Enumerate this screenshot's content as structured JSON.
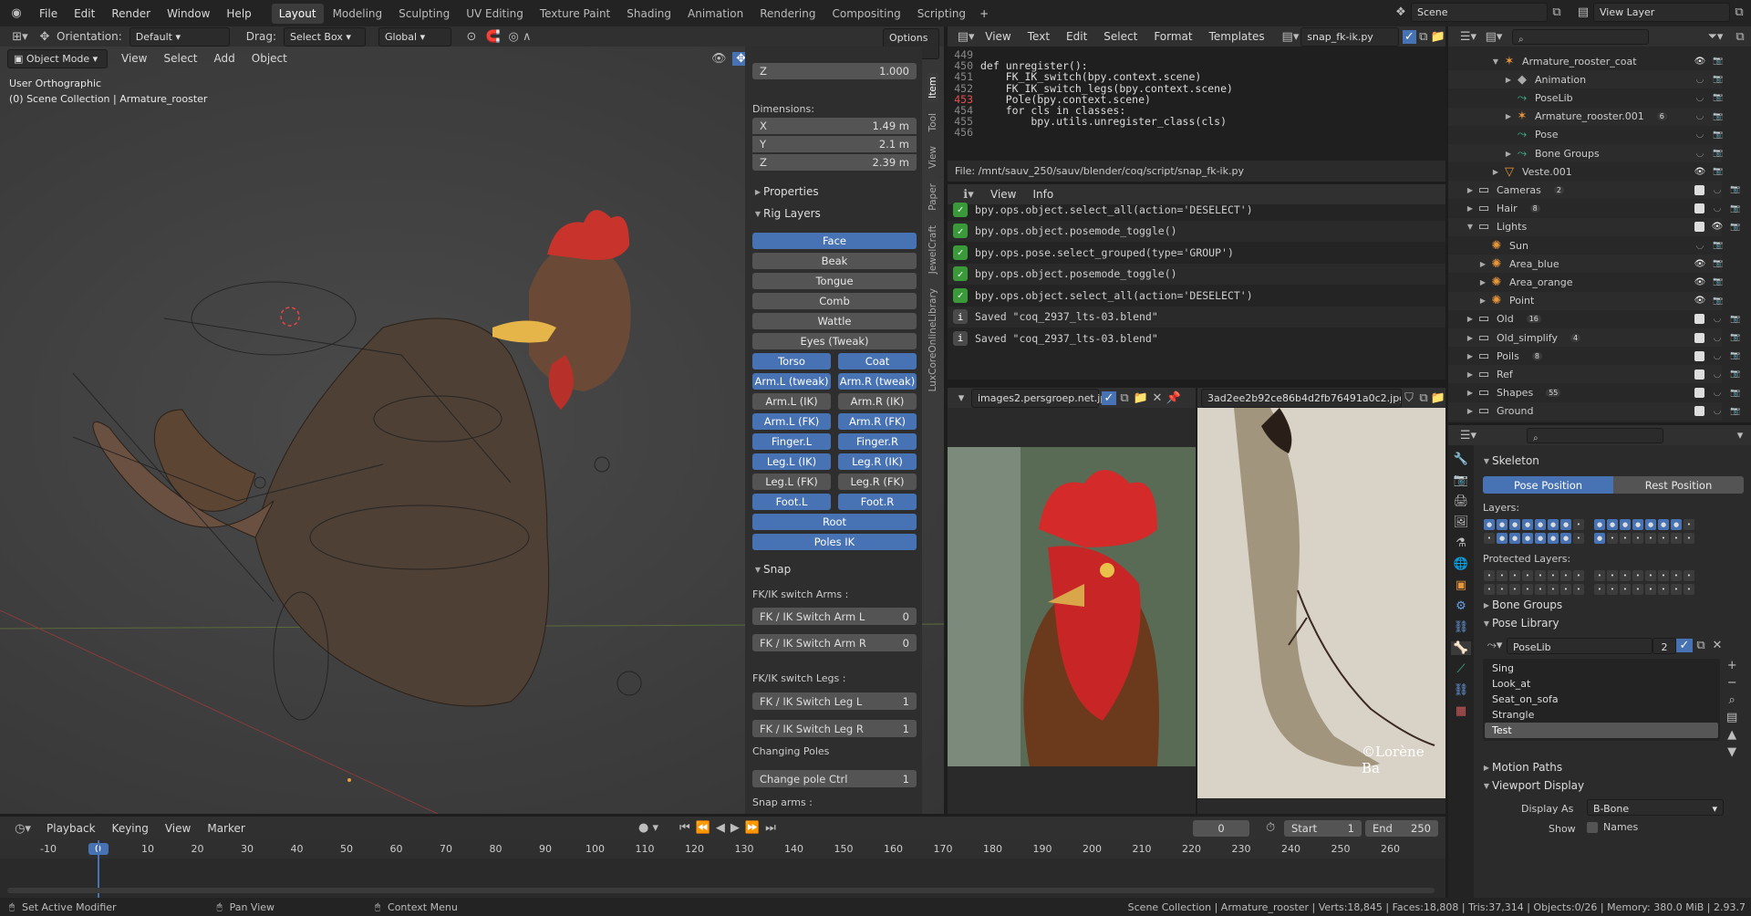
{
  "topbar": {
    "menus": [
      "File",
      "Edit",
      "Render",
      "Window",
      "Help"
    ],
    "workspaces": [
      "Layout",
      "Modeling",
      "Sculpting",
      "UV Editing",
      "Texture Paint",
      "Shading",
      "Animation",
      "Rendering",
      "Compositing",
      "Scripting"
    ],
    "active_workspace": "Layout",
    "add_tab": "+",
    "scene_label": "Scene",
    "view_layer_label": "View Layer"
  },
  "viewport": {
    "orientation_label": "Orientation:",
    "orientation_value": "Default",
    "drag_label": "Drag:",
    "drag_value": "Select Box",
    "transform_value": "Global",
    "options_label": "Options",
    "mode": "Object Mode",
    "menus": [
      "View",
      "Select",
      "Add",
      "Object"
    ],
    "overlay_line1": "User Orthographic",
    "overlay_line2": "(0) Scene Collection | Armature_rooster"
  },
  "npanel": {
    "z_label": "Z",
    "z_value": "1.000",
    "dimensions_label": "Dimensions:",
    "dims": [
      {
        "axis": "X",
        "value": "1.49 m"
      },
      {
        "axis": "Y",
        "value": "2.1 m"
      },
      {
        "axis": "Z",
        "value": "2.39 m"
      }
    ],
    "properties_label": "Properties",
    "rig_layers_label": "Rig Layers",
    "rig_buttons": [
      [
        {
          "label": "Face",
          "on": true
        }
      ],
      [
        {
          "label": "Beak",
          "on": false
        }
      ],
      [
        {
          "label": "Tongue",
          "on": false
        }
      ],
      [
        {
          "label": "Comb",
          "on": false
        }
      ],
      [
        {
          "label": "Wattle",
          "on": false
        }
      ],
      [
        {
          "label": "Eyes (Tweak)",
          "on": false
        }
      ],
      [
        {
          "label": "Torso",
          "on": true
        },
        {
          "label": "Coat",
          "on": true
        }
      ],
      [
        {
          "label": "Arm.L (tweak)",
          "on": true
        },
        {
          "label": "Arm.R (tweak)",
          "on": true
        }
      ],
      [
        {
          "label": "Arm.L (IK)",
          "on": false
        },
        {
          "label": "Arm.R (IK)",
          "on": false
        }
      ],
      [
        {
          "label": "Arm.L (FK)",
          "on": true
        },
        {
          "label": "Arm.R (FK)",
          "on": true
        }
      ],
      [
        {
          "label": "Finger.L",
          "on": true
        },
        {
          "label": "Finger.R",
          "on": true
        }
      ],
      [
        {
          "label": "Leg.L (IK)",
          "on": true
        },
        {
          "label": "Leg.R (IK)",
          "on": true
        }
      ],
      [
        {
          "label": "Leg.L (FK)",
          "on": false
        },
        {
          "label": "Leg.R (FK)",
          "on": false
        }
      ],
      [
        {
          "label": "Foot.L",
          "on": true
        },
        {
          "label": "Foot.R",
          "on": true
        }
      ],
      [
        {
          "label": "Root",
          "on": true
        }
      ],
      [
        {
          "label": "Poles IK",
          "on": true
        }
      ]
    ],
    "snap_label": "Snap",
    "fkik_arms_label": "FK/IK switch Arms :",
    "arm_l": {
      "label": "FK / IK Switch Arm L",
      "value": "0"
    },
    "arm_r": {
      "label": "FK / IK Switch Arm R",
      "value": "0"
    },
    "fkik_legs_label": "FK/IK switch Legs :",
    "leg_l": {
      "label": "FK / IK Switch Leg L",
      "value": "1"
    },
    "leg_r": {
      "label": "FK / IK Switch Leg R",
      "value": "1"
    },
    "changing_poles_label": "Changing Poles",
    "pole": {
      "label": "Change pole Ctrl",
      "value": "1"
    },
    "snap_arms_label": "Snap arms :",
    "side_tabs": [
      "Item",
      "Tool",
      "View",
      "Paper",
      "JewelCraft",
      "LuxCoreOnlineLibrary"
    ]
  },
  "text_editor": {
    "menus": [
      "View",
      "Text",
      "Edit",
      "Select",
      "Format",
      "Templates"
    ],
    "filename": "snap_fk-ik.py",
    "lines": [
      {
        "n": "449",
        "code": ""
      },
      {
        "n": "450",
        "code": "def unregister():"
      },
      {
        "n": "451",
        "code": "    FK_IK_switch(bpy.context.scene)"
      },
      {
        "n": "452",
        "code": "    FK_IK_switch_legs(bpy.context.scene)"
      },
      {
        "n": "453",
        "code": "    Pole(bpy.context.scene)"
      },
      {
        "n": "454",
        "code": "    for cls in classes:"
      },
      {
        "n": "455",
        "code": "        bpy.utils.unregister_class(cls)"
      },
      {
        "n": "456",
        "code": ""
      }
    ],
    "file_path": "File: /mnt/sauv_250/sauv/blender/coq/script/snap_fk-ik.py"
  },
  "info_editor": {
    "menus": [
      "View",
      "Info"
    ],
    "entries": [
      {
        "type": "op",
        "text": "bpy.ops.object.select_all(action='DESELECT')"
      },
      {
        "type": "op",
        "text": "bpy.ops.object.posemode_toggle()"
      },
      {
        "type": "op",
        "text": "bpy.ops.pose.select_grouped(type='GROUP')"
      },
      {
        "type": "op",
        "text": "bpy.ops.object.posemode_toggle()"
      },
      {
        "type": "op",
        "text": "bpy.ops.object.select_all(action='DESELECT')"
      },
      {
        "type": "info",
        "text": "Saved \"coq_2937_lts-03.blend\""
      },
      {
        "type": "info",
        "text": "Saved \"coq_2937_lts-03.blend\""
      }
    ]
  },
  "image_editors": [
    {
      "filename": "images2.persgroep.net.jpg"
    },
    {
      "filename": "3ad2ee2b92ce86b4d2fb76491a0c2.jpg",
      "watermark": "©Lorène Ba"
    }
  ],
  "outliner": {
    "rows": [
      {
        "indent": 3,
        "label": "Armature_rooster_coat",
        "icon": "armature-icon",
        "tri": "▼",
        "eye": true
      },
      {
        "indent": 4,
        "label": "Animation",
        "icon": "animation-icon",
        "tri": "▶",
        "eye": false
      },
      {
        "indent": 4,
        "label": "PoseLib",
        "icon": "poselib-icon",
        "tri": "",
        "eye": false
      },
      {
        "indent": 4,
        "label": "Armature_rooster.001",
        "icon": "armature-icon",
        "tri": "▶",
        "eye": false,
        "badge": "6"
      },
      {
        "indent": 4,
        "label": "Pose",
        "icon": "pose-icon",
        "tri": "",
        "eye": false
      },
      {
        "indent": 4,
        "label": "Bone Groups",
        "icon": "bone-groups-icon",
        "tri": "▶",
        "eye": false
      },
      {
        "indent": 3,
        "label": "Veste.001",
        "icon": "mesh-icon",
        "tri": "▶",
        "eye": true
      },
      {
        "indent": 1,
        "label": "Cameras",
        "icon": "collection-icon",
        "tri": "▶",
        "eye": false,
        "badge": "2"
      },
      {
        "indent": 1,
        "label": "Hair",
        "icon": "collection-icon",
        "tri": "▶",
        "eye": false,
        "badge": "8"
      },
      {
        "indent": 1,
        "label": "Lights",
        "icon": "collection-icon",
        "tri": "▼",
        "eye": true
      },
      {
        "indent": 2,
        "label": "Sun",
        "icon": "light-icon",
        "tri": "",
        "eye": false
      },
      {
        "indent": 2,
        "label": "Area_blue",
        "icon": "light-icon",
        "tri": "▶",
        "eye": true
      },
      {
        "indent": 2,
        "label": "Area_orange",
        "icon": "light-icon",
        "tri": "▶",
        "eye": true
      },
      {
        "indent": 2,
        "label": "Point",
        "icon": "light-icon",
        "tri": "▶",
        "eye": true
      },
      {
        "indent": 1,
        "label": "Old",
        "icon": "collection-icon",
        "tri": "▶",
        "eye": false,
        "badge": "16"
      },
      {
        "indent": 1,
        "label": "Old_simplify",
        "icon": "collection-icon",
        "tri": "▶",
        "eye": false,
        "badge": "4"
      },
      {
        "indent": 1,
        "label": "Poils",
        "icon": "collection-icon",
        "tri": "▶",
        "eye": false,
        "badge": "8"
      },
      {
        "indent": 1,
        "label": "Ref",
        "icon": "collection-icon",
        "tri": "▶",
        "eye": false
      },
      {
        "indent": 1,
        "label": "Shapes",
        "icon": "collection-icon",
        "tri": "▶",
        "eye": false,
        "badge": "55"
      },
      {
        "indent": 1,
        "label": "Ground",
        "icon": "collection-icon",
        "tri": "▶",
        "eye": false
      }
    ]
  },
  "properties": {
    "skeleton_label": "Skeleton",
    "pose_position": "Pose Position",
    "rest_position": "Rest Position",
    "layers_label": "Layers:",
    "protected_layers_label": "Protected Layers:",
    "bone_groups_label": "Bone Groups",
    "pose_library_label": "Pose Library",
    "poselib_name": "PoseLib",
    "poselib_users": "2",
    "poses": [
      "Sing",
      "Look_at",
      "Seat_on_sofa",
      "Strangle",
      "Test"
    ],
    "active_pose": "Test",
    "motion_paths_label": "Motion Paths",
    "viewport_display_label": "Viewport Display",
    "display_as_label": "Display As",
    "display_as_value": "B-Bone",
    "show_label": "Show",
    "names_label": "Names"
  },
  "timeline": {
    "menus": [
      "Playback",
      "Keying",
      "View",
      "Marker"
    ],
    "current_frame": "0",
    "start_label": "Start",
    "start_value": "1",
    "end_label": "End",
    "end_value": "250",
    "ticks": [
      "-10",
      "0",
      "10",
      "20",
      "30",
      "40",
      "50",
      "60",
      "70",
      "80",
      "90",
      "100",
      "110",
      "120",
      "130",
      "140",
      "150",
      "160",
      "170",
      "180",
      "190",
      "200",
      "210",
      "220",
      "230",
      "240",
      "250",
      "260"
    ]
  },
  "statusbar": {
    "left": [
      {
        "icon": "mouse-left-icon",
        "text": "Set Active Modifier"
      },
      {
        "icon": "mouse-middle-icon",
        "text": "Pan View"
      },
      {
        "icon": "mouse-right-icon",
        "text": "Context Menu"
      }
    ],
    "right": "Scene Collection | Armature_rooster | Verts:18,845 | Faces:18,808 | Tris:37,314 | Objects:0/26 | Memory: 380.0 MiB | 2.93.7"
  },
  "colors": {
    "accent": "#4772b3",
    "bg": "#1d1d1d",
    "panel": "#303030",
    "button": "#545454"
  }
}
